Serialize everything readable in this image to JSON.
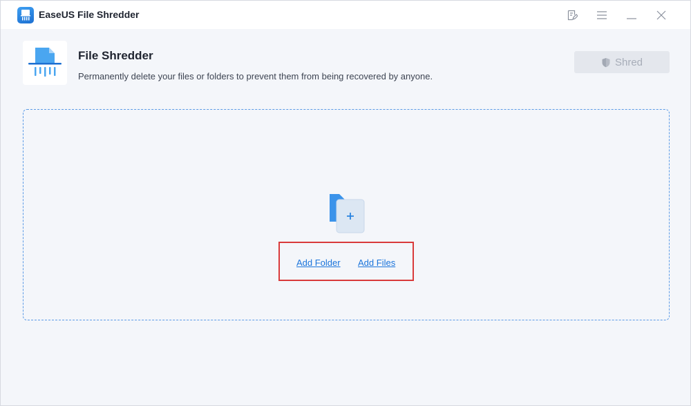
{
  "window": {
    "title": "EaseUS File Shredder"
  },
  "titlebar": {
    "icons": [
      "feedback-icon",
      "menu-icon",
      "minimize-icon",
      "close-icon"
    ]
  },
  "header": {
    "title": "File Shredder",
    "description": "Permanently delete your files or folders to prevent them from being recovered by anyone.",
    "shred_label": "Shred"
  },
  "dropzone": {
    "add_folder_label": "Add Folder",
    "add_files_label": "Add Files"
  },
  "colors": {
    "accent": "#1a74db",
    "highlight": "#d93a3a",
    "disabled_button": "#e4e7ed"
  }
}
